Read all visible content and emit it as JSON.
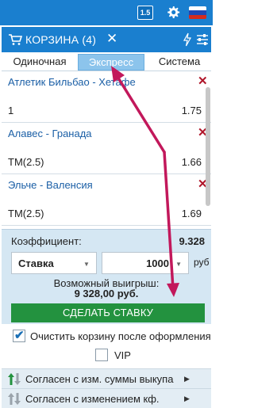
{
  "topbar": {
    "version_badge": "1.5",
    "icons": [
      "gear-icon",
      "flag-ru-icon"
    ]
  },
  "cart": {
    "title": "КОРЗИНА (4)",
    "close": "✕"
  },
  "tabs": [
    {
      "label": "Одиночная",
      "active": false
    },
    {
      "label": "Экспресс",
      "active": true
    },
    {
      "label": "Система",
      "active": false
    }
  ],
  "bets": [
    {
      "event": "Атлетик Бильбао - Хетафе",
      "type": "1",
      "coef": "1.75"
    },
    {
      "event": "Алавес - Гранада",
      "type": "ТМ(2.5)",
      "coef": "1.66"
    },
    {
      "event": "Эльче - Валенсия",
      "type": "ТМ(2.5)",
      "coef": "1.69"
    }
  ],
  "panel": {
    "coef_label": "Коэффициент:",
    "coef_value": "9.328",
    "select_value": "Ставка",
    "amount": "1000",
    "currency": "руб",
    "win_label": "Возможный выигрыш:",
    "win_value": "9 328,00 руб.",
    "button": "СДЕЛАТЬ СТАВКУ"
  },
  "options": {
    "clear_cart": "Очистить корзину после оформления",
    "clear_cart_checked": true,
    "vip": "VIP",
    "vip_checked": false
  },
  "agreements": [
    {
      "label": "Согласен с изм. суммы выкупа"
    },
    {
      "label": "Согласен с изменением кф."
    }
  ],
  "colors": {
    "brand": "#1a7fcf",
    "danger": "#b0162a",
    "success": "#23923f",
    "annotation": "#c2185b"
  }
}
